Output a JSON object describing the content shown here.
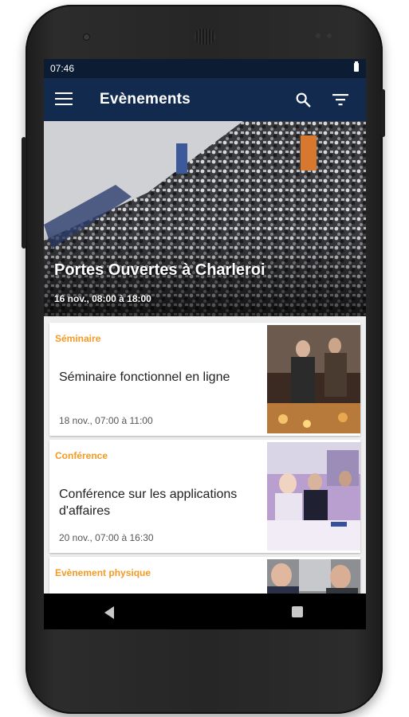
{
  "status_bar": {
    "time": "07:46",
    "battery_icon": "battery-full-icon"
  },
  "app_bar": {
    "title": "Evènements",
    "menu_icon": "hamburger-menu-icon",
    "search_icon": "search-icon",
    "filter_icon": "filter-icon",
    "background_color": "#112a4e"
  },
  "featured_event": {
    "title": "Portes Ouvertes à Charleroi",
    "date": "16 nov., 08:00 à 18:00",
    "image": "crowd-at-conference-hall-photo"
  },
  "events": [
    {
      "category": "Séminaire",
      "title": "Séminaire fonctionnel en ligne",
      "date": "18 nov., 07:00 à 11:00",
      "image": "people-at-networking-event-photo"
    },
    {
      "category": "Conférence",
      "title": "Conférence sur les applications d'affaires",
      "date": "20 nov., 07:00 à 16:30",
      "image": "conference-table-meeting-photo"
    },
    {
      "category": "Evènement physique",
      "title": "",
      "date": "",
      "image": "two-men-smiling-photo"
    }
  ],
  "accent_color": "#f59a23",
  "nav_bar": {
    "back_icon": "back-triangle-icon",
    "recents_icon": "recents-square-icon"
  }
}
